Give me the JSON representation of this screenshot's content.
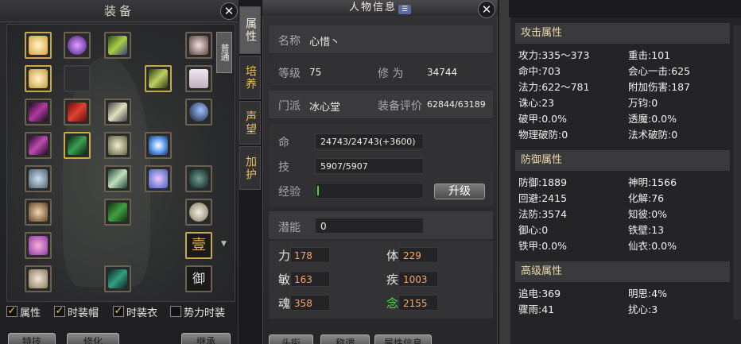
{
  "equipment_panel": {
    "title": "装备",
    "close": "✕",
    "normal_tag": "普通",
    "checkboxes": [
      {
        "label": "属性",
        "checked": true
      },
      {
        "label": "时装帽",
        "checked": true
      },
      {
        "label": "时装衣",
        "checked": true
      },
      {
        "label": "势力时装",
        "checked": false
      }
    ],
    "bottom_buttons": [
      "特技",
      "修化",
      "继承"
    ]
  },
  "tabs": [
    "属性",
    "培养",
    "声望",
    "加护"
  ],
  "info_panel": {
    "title": "人物信息",
    "close": "✕",
    "name_label": "名称",
    "name_value": "心惜丶",
    "level_label": "等级",
    "level_value": "75",
    "cultivation_label": "修 为",
    "cultivation_value": "34744",
    "sect_label": "门派",
    "sect_value": "冰心堂",
    "gear_score_label": "装备评价",
    "gear_score_value": "62844/63189",
    "hp_label": "命",
    "hp_value": "24743/24743(+3600)",
    "mp_label": "技",
    "mp_value": "5907/5907",
    "exp_label": "经验",
    "exp_fraction": 0.0,
    "upgrade_button": "升级",
    "potential_label": "潜能",
    "potential_value": "0",
    "stats": [
      {
        "label": "力",
        "value": "178"
      },
      {
        "label": "体",
        "value": "229"
      },
      {
        "label": "敏",
        "value": "163"
      },
      {
        "label": "疾",
        "value": "1003"
      },
      {
        "label": "魂",
        "value": "358"
      },
      {
        "label": "念",
        "value": "2155"
      }
    ],
    "bottom_buttons": [
      "头衔",
      "称谓",
      "属性信息"
    ]
  },
  "attributes": {
    "attack_header": "攻击属性",
    "attack": [
      "攻力:335～373",
      "重击:101",
      "命中:703",
      "会心一击:625",
      "法力:622～781",
      "附加伤害:187",
      "诛心:23",
      "万钧:0",
      "破甲:0.0%",
      "透魔:0.0%",
      "物理破防:0",
      "法术破防:0"
    ],
    "defense_header": "防御属性",
    "defense": [
      "防御:1889",
      "神明:1566",
      "回避:2415",
      "化解:76",
      "法防:3574",
      "知彼:0%",
      "御心:0",
      "铁壁:13",
      "铁甲:0.0%",
      "仙衣:0.0%"
    ],
    "advanced_header": "高级属性",
    "advanced": [
      "追电:369",
      "明思:4%",
      "骤雨:41",
      "扰心:3"
    ]
  },
  "colors": {
    "accent_gold": "#e8c05a",
    "stat_orange": "#f2a866",
    "stat_green": "#5ad65a"
  }
}
